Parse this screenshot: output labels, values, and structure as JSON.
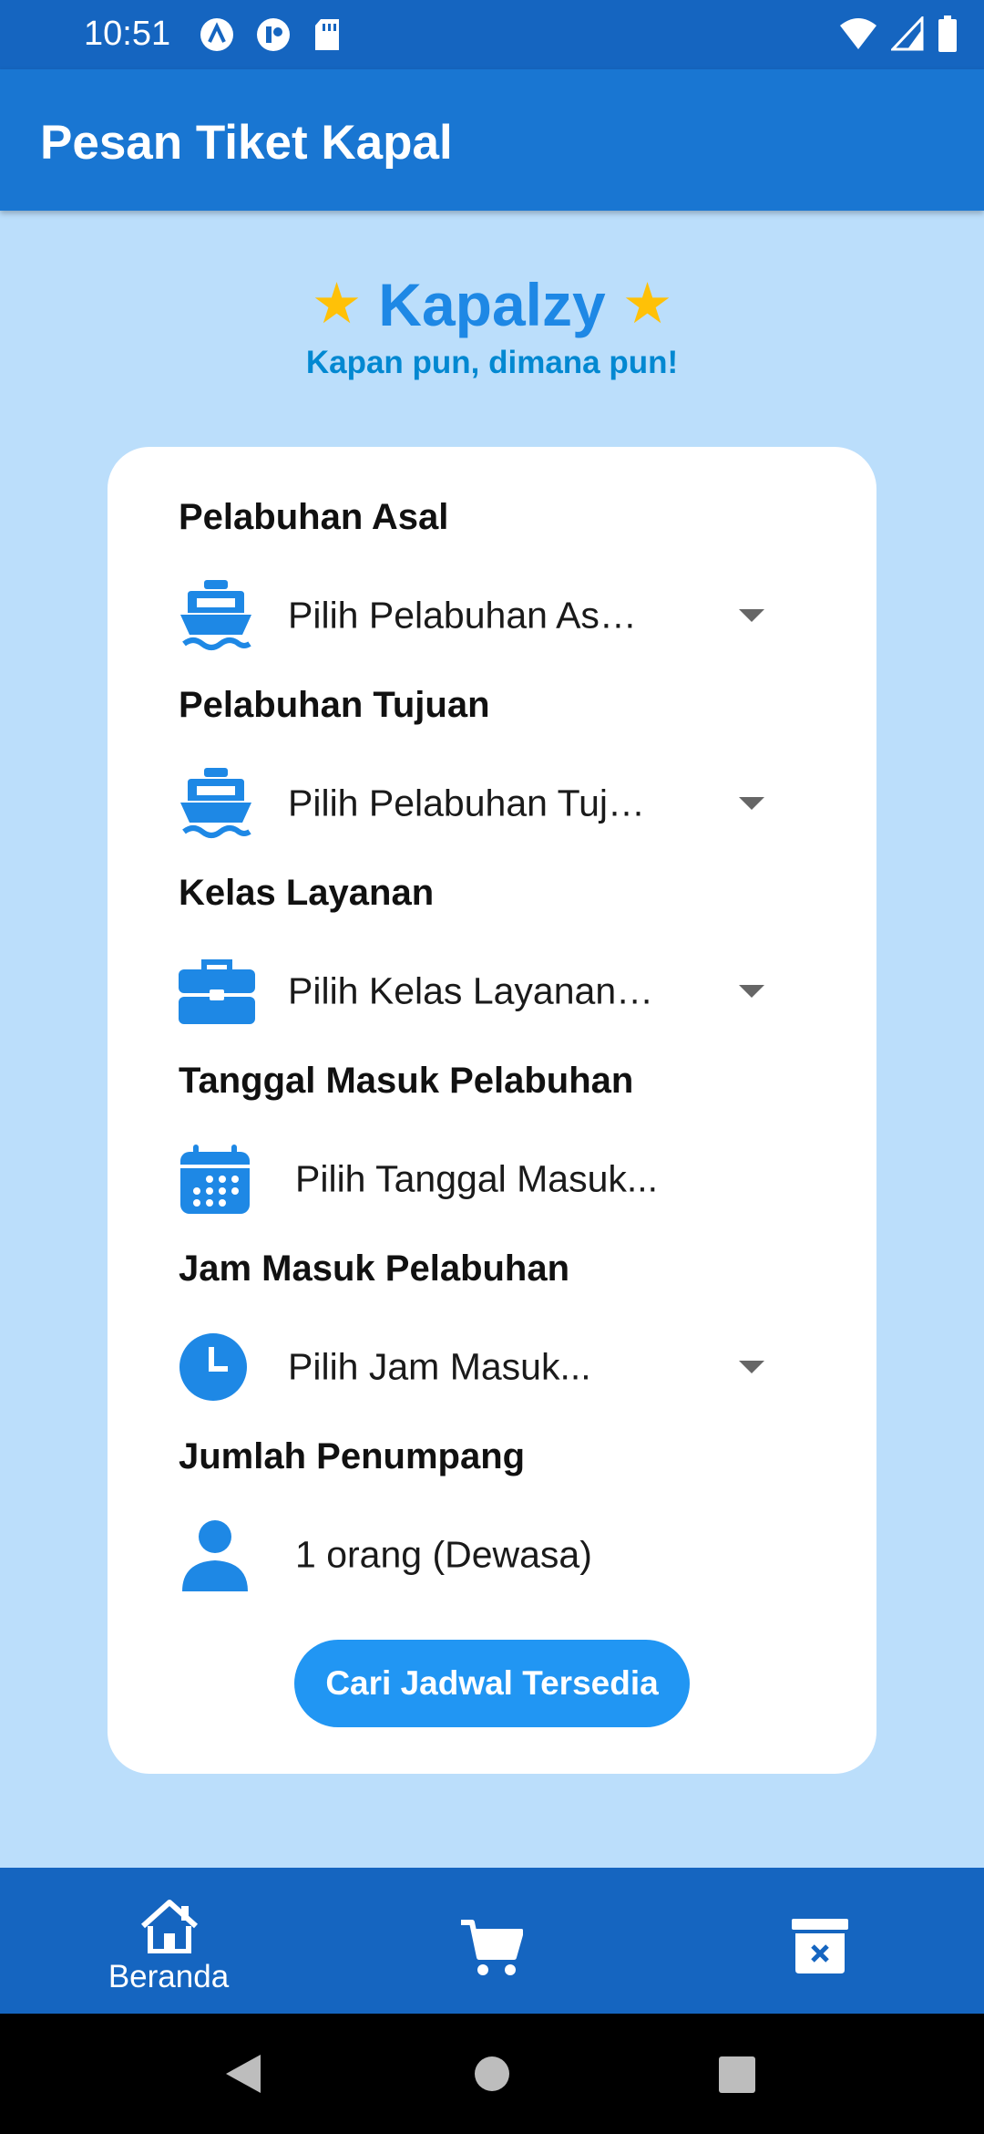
{
  "status_bar": {
    "time": "10:51",
    "left_icons": [
      "app-a-icon",
      "app-round-icon",
      "sd-card-icon"
    ],
    "right_icons": [
      "wifi-icon",
      "signal-icon",
      "battery-icon"
    ]
  },
  "app_bar": {
    "title": "Pesan Tiket Kapal"
  },
  "brand": {
    "star": "★",
    "name": "Kapalzy",
    "tagline": "Kapan pun, dimana pun!"
  },
  "form": {
    "origin": {
      "label": "Pelabuhan Asal",
      "value": "Pilih Pelabuhan As…",
      "icon": "ship-icon"
    },
    "destination": {
      "label": "Pelabuhan Tujuan",
      "value": "Pilih Pelabuhan Tuj…",
      "icon": "ship-icon"
    },
    "service_class": {
      "label": "Kelas Layanan",
      "value": "Pilih Kelas Layanan…",
      "icon": "briefcase-icon"
    },
    "date": {
      "label": "Tanggal Masuk Pelabuhan",
      "value": "Pilih Tanggal Masuk...",
      "icon": "calendar-icon"
    },
    "time": {
      "label": "Jam Masuk Pelabuhan",
      "value": "Pilih Jam Masuk...",
      "icon": "clock-icon"
    },
    "passengers": {
      "label": "Jumlah Penumpang",
      "value": "1 orang (Dewasa)",
      "icon": "person-icon"
    },
    "search_button": "Cari Jadwal Tersedia"
  },
  "bottom_nav": {
    "items": [
      {
        "label": "Beranda",
        "icon": "home-icon",
        "active": true
      },
      {
        "label": "",
        "icon": "cart-icon"
      },
      {
        "label": "",
        "icon": "delete-box-icon"
      }
    ]
  },
  "colors": {
    "primary_dark": "#1565c0",
    "primary": "#1976d2",
    "accent": "#2196f3",
    "background": "#bbdefb",
    "star": "#ffc107",
    "icon": "#1e88e5"
  }
}
